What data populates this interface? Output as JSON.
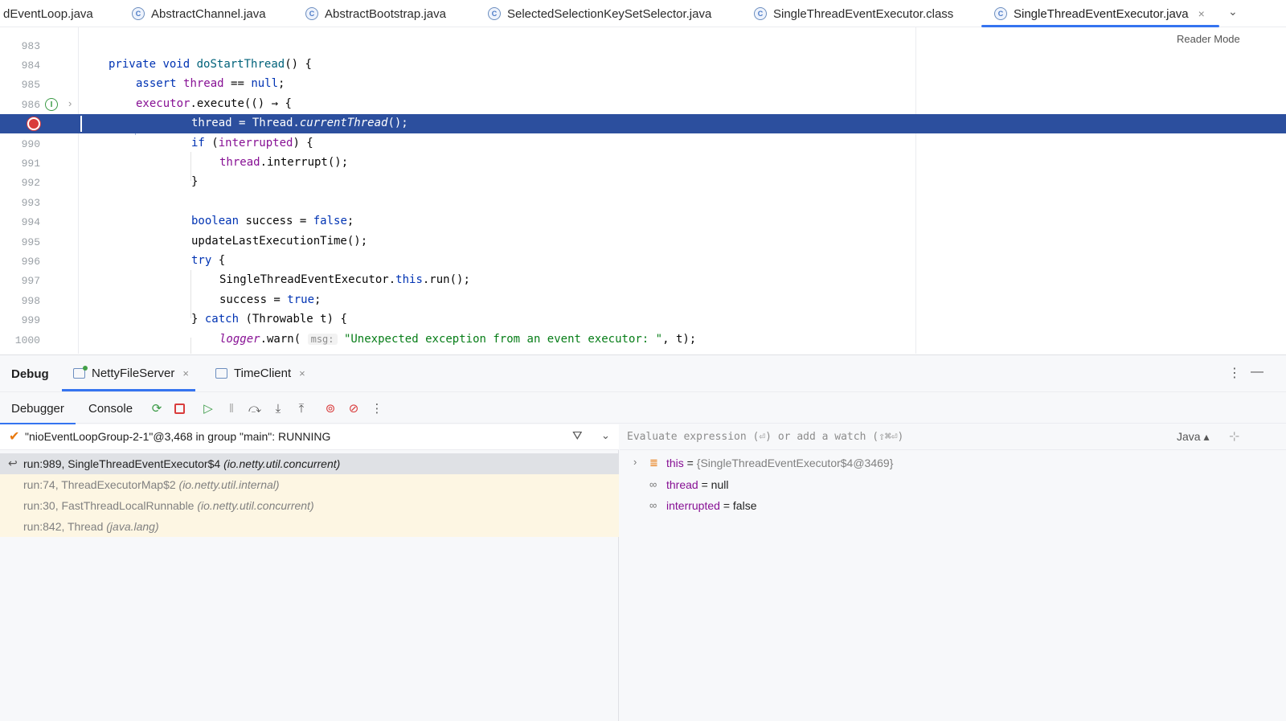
{
  "tabs": [
    {
      "label": "dEventLoop.java"
    },
    {
      "label": "AbstractChannel.java"
    },
    {
      "label": "AbstractBootstrap.java"
    },
    {
      "label": "SelectedSelectionKeySetSelector.java"
    },
    {
      "label": "SingleThreadEventExecutor.class"
    },
    {
      "label": "SingleThreadEventExecutor.java",
      "active": true
    }
  ],
  "tab_close": "×",
  "tab_more": "⌄",
  "reader_mode": "Reader Mode",
  "editor": {
    "lines": [
      {
        "num": "983"
      },
      {
        "num": "984"
      },
      {
        "num": "985"
      },
      {
        "num": "986"
      },
      {
        "num": ""
      },
      {
        "num": "990"
      },
      {
        "num": "991"
      },
      {
        "num": "992"
      },
      {
        "num": "993"
      },
      {
        "num": "994"
      },
      {
        "num": "995"
      },
      {
        "num": "996"
      },
      {
        "num": "997"
      },
      {
        "num": "998"
      },
      {
        "num": "999"
      },
      {
        "num": "1000"
      }
    ],
    "code": {
      "l984_kw1": "private",
      "l984_kw2": "void",
      "l984_fn": "doStartThread",
      "l984_rest": "() {",
      "l985_kw": "assert",
      "l985_fld": "thread",
      "l985_op": " == ",
      "l985_kw2": "null",
      "l985_end": ";",
      "l986_fld": "executor",
      "l986_rest": ".execute(() → {",
      "l989_a": "thread = Thread.",
      "l989_it": "currentThread",
      "l989_b": "();",
      "l990_kw": "if",
      "l990_a": " (",
      "l990_fld": "interrupted",
      "l990_b": ") {",
      "l991_fld": "thread",
      "l991_rest": ".interrupt();",
      "l992": "}",
      "l994_kw": "boolean",
      "l994_a": " success = ",
      "l994_kw2": "false",
      "l994_b": ";",
      "l995": "updateLastExecutionTime();",
      "l996_kw": "try",
      "l996_b": " {",
      "l997_a": "SingleThreadEventExecutor.",
      "l997_kw": "this",
      "l997_b": ".run();",
      "l998_a": "success = ",
      "l998_kw": "true",
      "l998_b": ";",
      "l999_a": "} ",
      "l999_kw": "catch",
      "l999_b": " (Throwable t) {",
      "l1000_fld": "logger",
      "l1000_a": ".warn( ",
      "l1000_hint": "msg:",
      "l1000_str": "\"Unexpected exception from an event executor: \"",
      "l1000_b": ", t);"
    }
  },
  "debug": {
    "title": "Debug",
    "sessions": [
      {
        "label": "NettyFileServer"
      },
      {
        "label": "TimeClient"
      }
    ],
    "subtabs": {
      "debugger": "Debugger",
      "console": "Console"
    },
    "thread": "\"nioEventLoopGroup-2-1\"@3,468 in group \"main\": RUNNING",
    "frames": [
      {
        "method": "run:989, SingleThreadEventExecutor$4",
        "pkg": "(io.netty.util.concurrent)"
      },
      {
        "method": "run:74, ThreadExecutorMap$2",
        "pkg": "(io.netty.util.internal)"
      },
      {
        "method": "run:30, FastThreadLocalRunnable",
        "pkg": "(io.netty.util.concurrent)"
      },
      {
        "method": "run:842, Thread",
        "pkg": "(java.lang)"
      }
    ],
    "eval_placeholder": "Evaluate expression (⏎) or add a watch (⇧⌘⏎)",
    "eval_lang": "Java ▴",
    "variables": [
      {
        "name": "this",
        "eq": " = ",
        "value": "{SingleThreadEventExecutor$4@3469}"
      },
      {
        "name": "thread",
        "eq": " = ",
        "value": "null"
      },
      {
        "name": "interrupted",
        "eq": " = ",
        "value": "false"
      }
    ]
  },
  "colors": {
    "accent": "#3574f0",
    "exec_line": "#2c4f9e",
    "breakpoint": "#d93c3c",
    "keyword": "#0033b3",
    "field": "#871094"
  }
}
